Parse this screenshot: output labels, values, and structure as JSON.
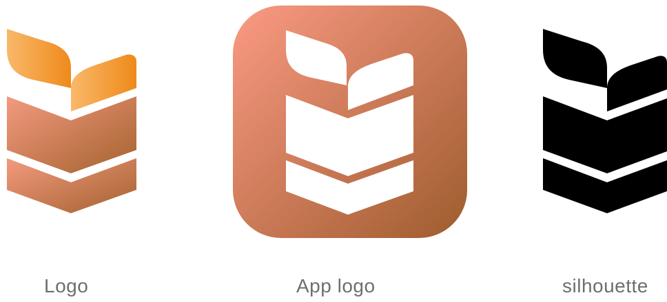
{
  "variants": [
    {
      "id": "logo",
      "caption": "Logo",
      "style": "gradient"
    },
    {
      "id": "app-logo",
      "caption": "App logo",
      "style": "app-icon"
    },
    {
      "id": "silhouette",
      "caption": "silhouette",
      "style": "black"
    }
  ],
  "colors": {
    "leaf_gradient_start": "#f9b86a",
    "leaf_gradient_end": "#ef8a1a",
    "body_gradient_start": "#f39a7f",
    "body_gradient_end": "#a3622e",
    "app_bg_start": "#fb9a83",
    "app_bg_end": "#9e5c2e",
    "app_glyph": "#ffffff",
    "silhouette": "#000000",
    "caption": "#6e6e6e"
  }
}
